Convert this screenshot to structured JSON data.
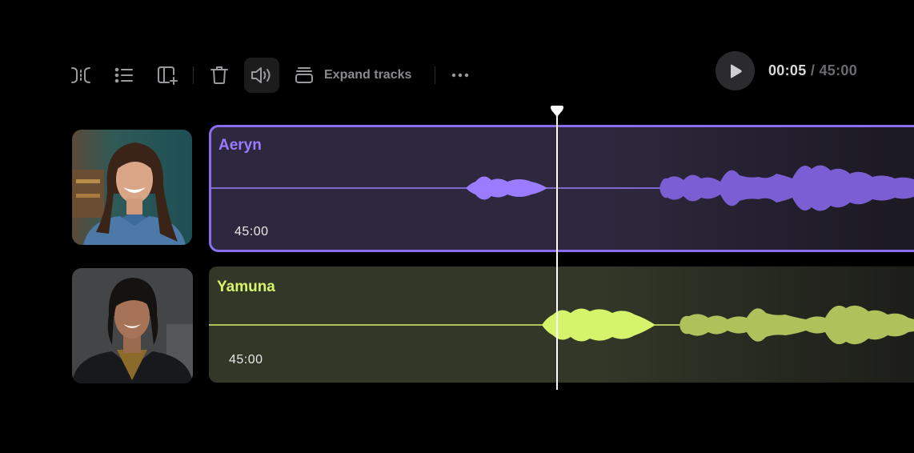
{
  "toolbar": {
    "icons": [
      "split-icon",
      "list-icon",
      "add-layout-icon",
      "trash-icon",
      "volume-icon",
      "layers-icon",
      "more-icon"
    ],
    "expand_label": "Expand tracks"
  },
  "player": {
    "current_time": "00:05",
    "separator": "/",
    "total_time": "45:00",
    "playhead_fraction": 0.0001
  },
  "tracks": [
    {
      "name": "Aeryn",
      "duration": "45:00",
      "color": "#9b7bff",
      "selected": true
    },
    {
      "name": "Yamuna",
      "duration": "45:00",
      "color": "#d6f46b",
      "selected": false
    }
  ],
  "colors": {
    "background": "#000000",
    "track1_accent": "#8b6ef0",
    "track2_accent": "#d6f46b",
    "playhead": "#ffffff"
  }
}
